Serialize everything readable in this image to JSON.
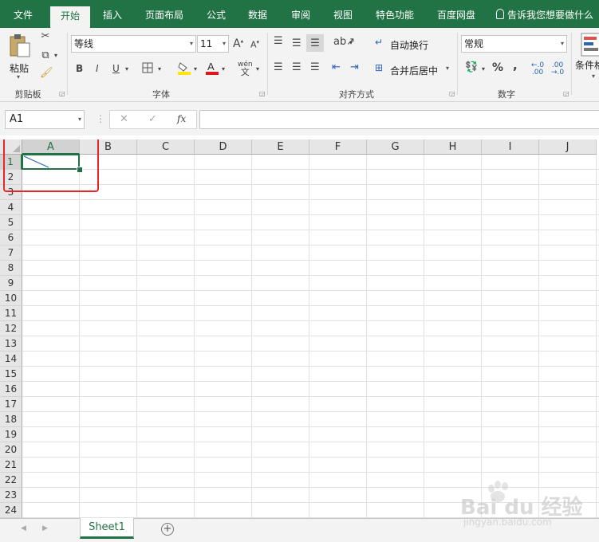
{
  "tabs": [
    "文件",
    "开始",
    "插入",
    "页面布局",
    "公式",
    "数据",
    "审阅",
    "视图",
    "特色功能",
    "百度网盘"
  ],
  "active_tab": "开始",
  "tell_me": "告诉我您想要做什么",
  "clipboard": {
    "paste_label": "粘贴",
    "group_label": "剪贴板"
  },
  "font": {
    "name": "等线",
    "size": "11",
    "group_label": "字体",
    "bold": "B",
    "italic": "I",
    "underline": "U",
    "wen": "wén",
    "wen_char": "文",
    "font_color": "#e0141b",
    "fill_color": "#ffe600"
  },
  "alignment": {
    "wrap_text": "自动换行",
    "merge_center": "合并后居中",
    "group_label": "对齐方式"
  },
  "number": {
    "format": "常规",
    "percent": "%",
    "comma": ",",
    "group_label": "数字"
  },
  "styles": {
    "conditional_label": "条件格"
  },
  "formula_bar": {
    "name_box": "A1",
    "fx": "fx",
    "cancel": "✕",
    "enter": "✓",
    "value": ""
  },
  "columns": [
    "A",
    "B",
    "C",
    "D",
    "E",
    "F",
    "G",
    "H",
    "I",
    "J"
  ],
  "rows": [
    "1",
    "2",
    "3",
    "4",
    "5",
    "6",
    "7",
    "8",
    "9",
    "10",
    "11",
    "12",
    "13",
    "14",
    "15",
    "16",
    "17",
    "18",
    "19",
    "20",
    "21",
    "22",
    "23",
    "24"
  ],
  "selected_cell": "A1",
  "highlight_color": "#e8262a",
  "accent_color": "#217346",
  "sheet_tab": "Sheet1",
  "add_sheet": "+",
  "watermark": {
    "brand": "Bai du 经验",
    "url": "jingyan.baidu.com"
  }
}
